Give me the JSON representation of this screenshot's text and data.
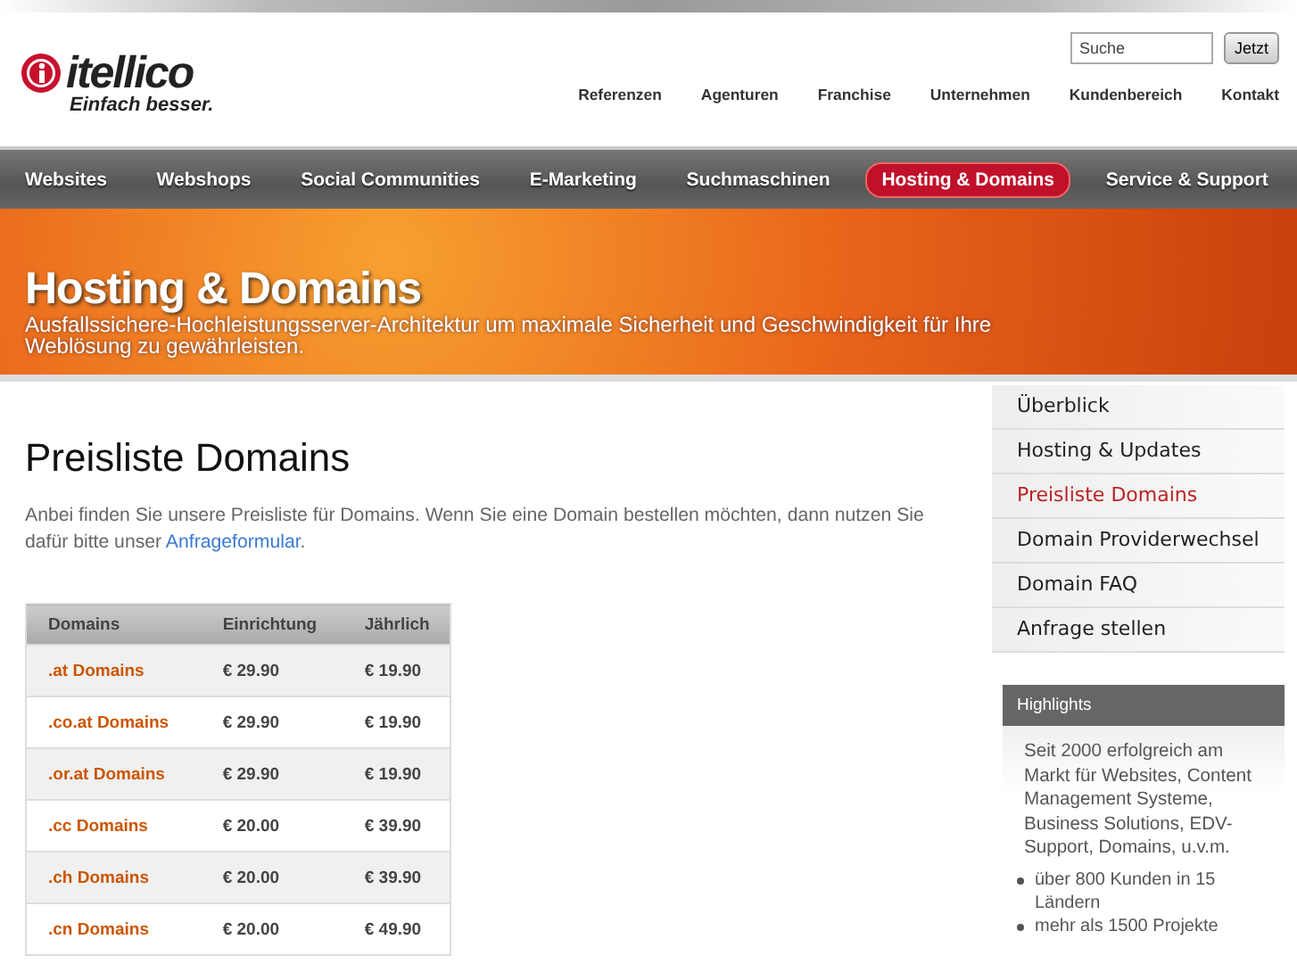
{
  "header": {
    "logo": {
      "name": "itellico",
      "tagline": "Einfach besser."
    },
    "search": {
      "placeholder": "Suche",
      "button": "Jetzt"
    },
    "top_nav": [
      "Referenzen",
      "Agenturen",
      "Franchise",
      "Unternehmen",
      "Kundenbereich",
      "Kontakt"
    ]
  },
  "main_nav": [
    {
      "label": "Websites",
      "selected": false
    },
    {
      "label": "Webshops",
      "selected": false
    },
    {
      "label": "Social Communities",
      "selected": false
    },
    {
      "label": "E-Marketing",
      "selected": false
    },
    {
      "label": "Suchmaschinen",
      "selected": false
    },
    {
      "label": "Hosting & Domains",
      "selected": true
    },
    {
      "label": "Service & Support",
      "selected": false
    }
  ],
  "banner": {
    "title": "Hosting & Domains",
    "subtitle": "Ausfallssichere-Hochleistungsserver-Architektur um maximale Sicherheit und Geschwindigkeit für Ihre Weblösung zu gewährleisten."
  },
  "content": {
    "heading": "Preisliste Domains",
    "intro": "Anbei finden Sie unsere Preisliste für Domains. Wenn Sie eine Domain bestellen möchten, dann nutzen Sie dafür bitte unser",
    "link": "Anfrageformular",
    "after_link": ".",
    "table": {
      "columns": [
        "Domains",
        "Einrichtung",
        "Jährlich"
      ],
      "rows": [
        [
          ".at Domains",
          "€ 29.90",
          "€ 19.90"
        ],
        [
          ".co.at Domains",
          "€ 29.90",
          "€ 19.90"
        ],
        [
          ".or.at Domains",
          "€ 29.90",
          "€ 19.90"
        ],
        [
          ".cc Domains",
          "€ 20.00",
          "€ 39.90"
        ],
        [
          ".ch Domains",
          "€ 20.00",
          "€ 39.90"
        ],
        [
          ".cn Domains",
          "€ 20.00",
          "€ 49.90"
        ]
      ]
    }
  },
  "sidebar": {
    "items": [
      {
        "label": "Überblick",
        "selected": false
      },
      {
        "label": "Hosting & Updates",
        "selected": false
      },
      {
        "label": "Preisliste Domains",
        "selected": true
      },
      {
        "label": "Domain Providerwechsel",
        "selected": false
      },
      {
        "label": "Domain FAQ",
        "selected": false
      },
      {
        "label": "Anfrage stellen",
        "selected": false
      }
    ],
    "highlights": {
      "title": "Highlights",
      "text": "Seit 2000 erfolgreich am Markt für Websites, Content Management Systeme, Business Solutions, EDV-Support, Domains, u.v.m.",
      "bullets": [
        "über 800 Kunden in 15 Ländern",
        "mehr als 1500 Projekte"
      ]
    }
  }
}
